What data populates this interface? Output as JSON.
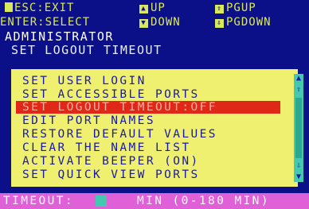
{
  "hints": {
    "esc": "ESC:EXIT",
    "up": "UP",
    "pgup": "PGUP",
    "enter": "ENTER:SELECT",
    "down": "DOWN",
    "pgdown": "PGDOWN"
  },
  "header": {
    "title": "ADMINISTRATOR",
    "subtitle": "SET LOGOUT TIMEOUT"
  },
  "menu": {
    "items": [
      "SET USER LOGIN",
      "SET ACCESSIBLE PORTS",
      "SET LOGOUT TIMEOUT:OFF",
      "EDIT PORT NAMES",
      "RESTORE DEFAULT VALUES",
      "CLEAR THE NAME LIST",
      "ACTIVATE BEEPER (ON)",
      "SET QUICK VIEW PORTS"
    ],
    "selected_index": 2
  },
  "status": {
    "label": "TIMEOUT:",
    "input_value": "",
    "range": "MIN (0-180 MIN)"
  },
  "colors": {
    "background": "#0c1088",
    "menu_bg": "#f0f070",
    "menu_text": "#1a1aa0",
    "selected_bg": "#e02818",
    "status_bg": "#e060d8",
    "accent_cyan": "#44c8b0"
  }
}
